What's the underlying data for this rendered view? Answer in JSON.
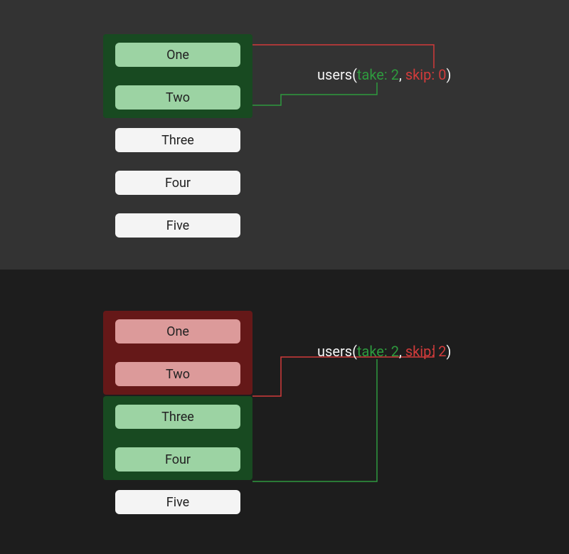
{
  "top": {
    "items": [
      "One",
      "Two",
      "Three",
      "Four",
      "Five"
    ],
    "highlight_green": [
      0,
      1
    ],
    "highlight_red": [],
    "query": {
      "fn": "users",
      "take_label": "take: 2",
      "skip_label": "skip: 0"
    }
  },
  "bottom": {
    "items": [
      "One",
      "Two",
      "Three",
      "Four",
      "Five"
    ],
    "highlight_green": [
      2,
      3
    ],
    "highlight_red": [
      0,
      1
    ],
    "query": {
      "fn": "users",
      "take_label": "take: 2",
      "skip_label": "skip: 2"
    }
  },
  "colors": {
    "green": "#2e9a3e",
    "red": "#d23b3b"
  }
}
